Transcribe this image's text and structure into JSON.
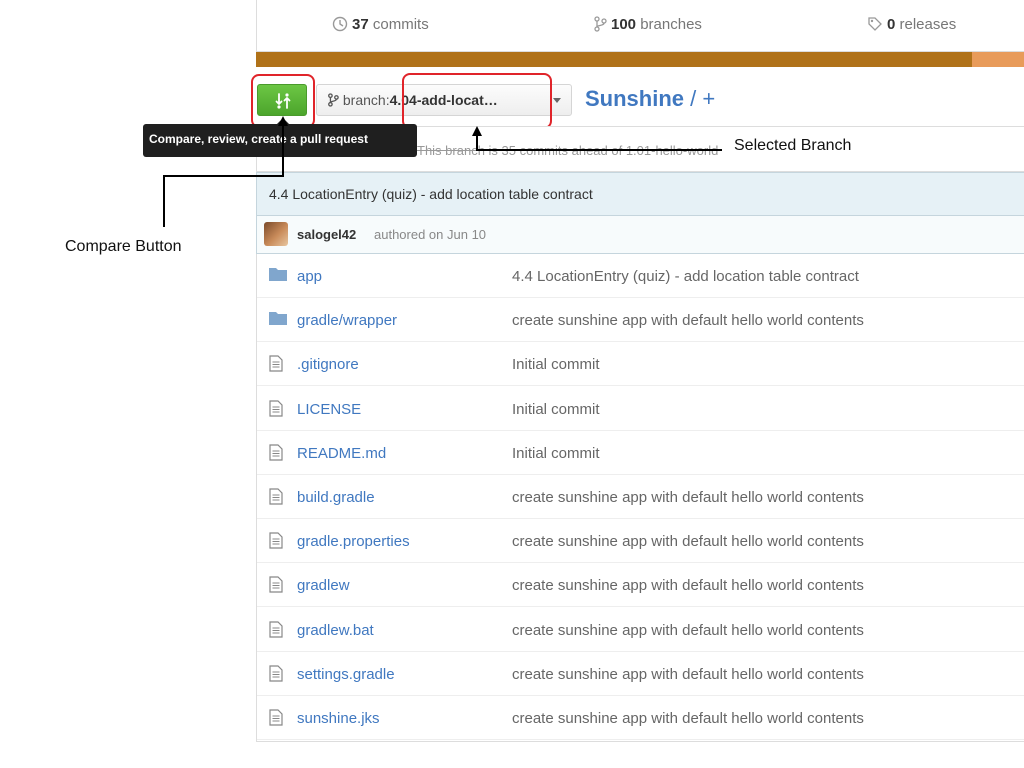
{
  "stats": {
    "commits_count": "37",
    "commits_label": "commits",
    "branches_count": "100",
    "branches_label": "branches",
    "releases_count": "0",
    "releases_label": "releases",
    "icons": [
      "history-icon",
      "branch-icon",
      "tag-icon"
    ]
  },
  "toolbar": {
    "branch_prefix": "branch:",
    "branch_name": "4.04-add-locat…",
    "repo_name": "Sunshine",
    "path_sep": " / ",
    "add_file": "+"
  },
  "tooltip": {
    "text": "Compare, review, create a pull request"
  },
  "ahead_notice": "This branch is 35 commits ahead of 1.01-hello-world",
  "commit": {
    "message": "4.4 LocationEntry (quiz) - add location table contract",
    "author": "salogel42",
    "authored": "authored on Jun 10"
  },
  "files": [
    {
      "name": "app",
      "type": "folder",
      "message": "4.4 LocationEntry (quiz) - add location table contract"
    },
    {
      "name": "gradle/wrapper",
      "type": "folder",
      "message": "create sunshine app with default hello world contents"
    },
    {
      "name": ".gitignore",
      "type": "file",
      "message": "Initial commit"
    },
    {
      "name": "LICENSE",
      "type": "file",
      "message": "Initial commit"
    },
    {
      "name": "README.md",
      "type": "file",
      "message": "Initial commit"
    },
    {
      "name": "build.gradle",
      "type": "file",
      "message": "create sunshine app with default hello world contents"
    },
    {
      "name": "gradle.properties",
      "type": "file",
      "message": "create sunshine app with default hello world contents"
    },
    {
      "name": "gradlew",
      "type": "file",
      "message": "create sunshine app with default hello world contents"
    },
    {
      "name": "gradlew.bat",
      "type": "file",
      "message": "create sunshine app with default hello world contents"
    },
    {
      "name": "settings.gradle",
      "type": "file",
      "message": "create sunshine app with default hello world contents"
    },
    {
      "name": "sunshine.jks",
      "type": "file",
      "message": "create sunshine app with default hello world contents"
    }
  ],
  "annotations": {
    "compare_button": "Compare Button",
    "selected_branch": "Selected Branch"
  },
  "colors": {
    "compare_green": "#6cc644",
    "link_blue": "#4078c0",
    "highlight_red": "#e0242a",
    "language_primary": "#b07219"
  }
}
